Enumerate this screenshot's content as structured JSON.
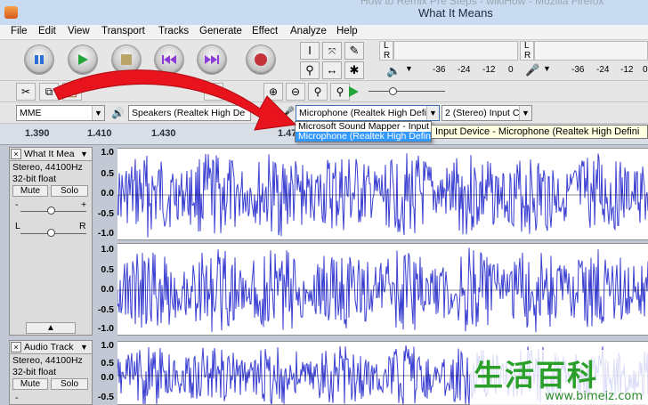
{
  "window": {
    "ghost_title": "How to Remix Pre Steps - wikiHow - Mozilla Firefox",
    "title": "What It Means"
  },
  "menu": [
    "File",
    "Edit",
    "View",
    "Transport",
    "Tracks",
    "Generate",
    "Effect",
    "Analyze",
    "Help"
  ],
  "meter": {
    "left_channel": "L",
    "right_channel": "R",
    "scale": [
      "-36",
      "-24",
      "-12",
      "0"
    ],
    "scale2": [
      "-36",
      "-24",
      "-12",
      "0"
    ]
  },
  "device": {
    "host": "MME",
    "output": "Speakers (Realtek High De",
    "input": "Microphone (Realtek High Defi",
    "channels": "2 (Stereo) Input C",
    "dropdown_options": [
      "Microsoft Sound Mapper - Input",
      "Microphone (Realtek High Defini"
    ],
    "tooltip": "Input Device - Microphone (Realtek High Defini"
  },
  "timeline": [
    "1.390",
    "1.410",
    "1.430",
    "1.47"
  ],
  "tracks": [
    {
      "name": "What It Mea",
      "format": "Stereo, 44100Hz",
      "bitdepth": "32-bit float",
      "mute": "Mute",
      "solo": "Solo",
      "gain_minus": "-",
      "gain_plus": "+",
      "pan_left": "L",
      "pan_right": "R",
      "scale_top": [
        "1.0",
        "0.5",
        "0.0",
        "-0.5",
        "-1.0"
      ],
      "scale_bottom": [
        "1.0",
        "0.5",
        "0.0",
        "-0.5",
        "-1.0"
      ]
    },
    {
      "name": "Audio Track",
      "format": "Stereo, 44100Hz",
      "bitdepth": "32-bit float",
      "mute": "Mute",
      "solo": "Solo",
      "scale_top": [
        "1.0",
        "0.5",
        "0.0",
        "-0.5"
      ]
    }
  ],
  "watermark": {
    "text": "生活百科",
    "url": "www.bimeiz.com"
  },
  "colors": {
    "waveform": "#3a3fd1",
    "arrow": "#e8131c",
    "selection": "#3399ff"
  }
}
